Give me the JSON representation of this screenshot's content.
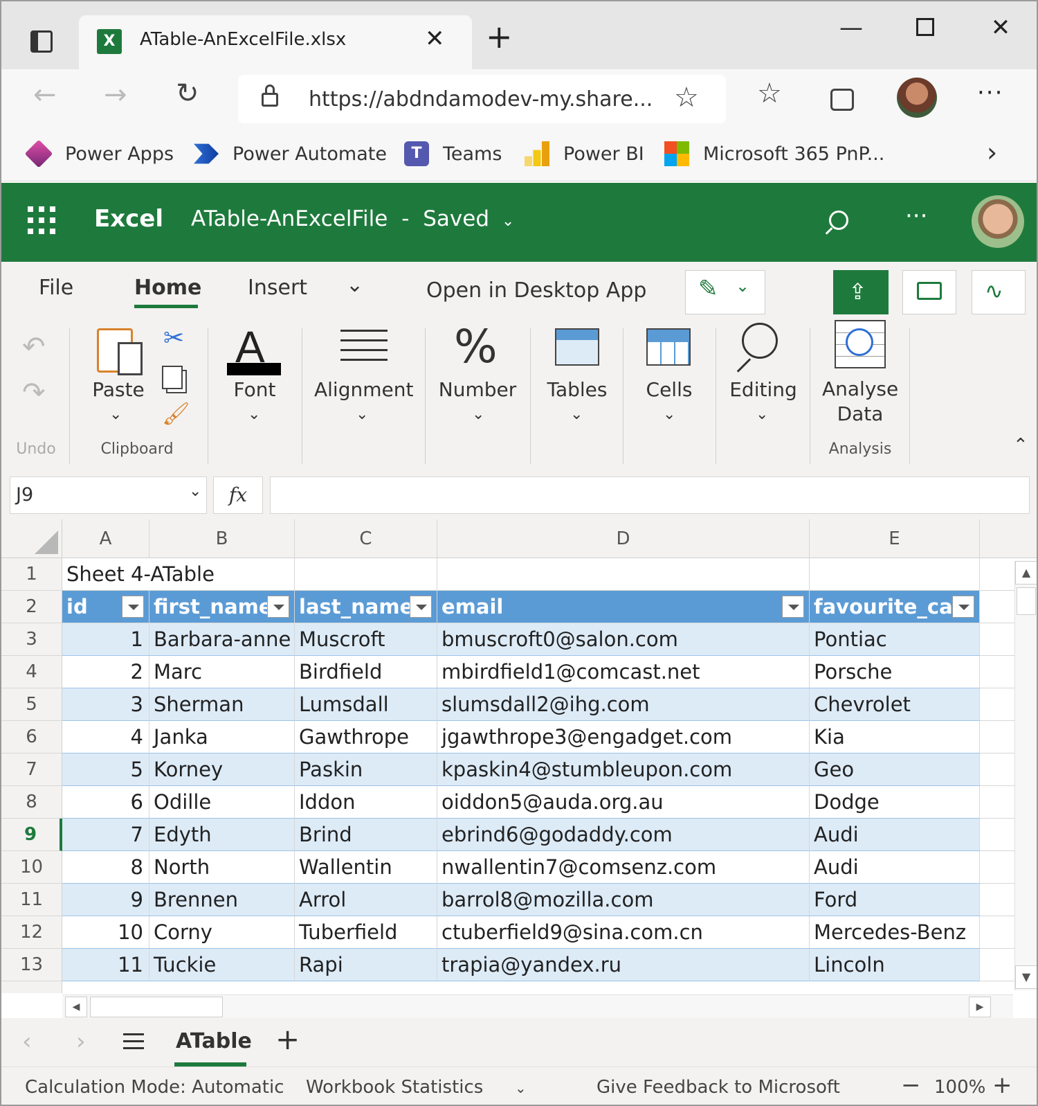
{
  "browser": {
    "tab_title": "ATable-AnExcelFile.xlsx",
    "url": "https://abdndamodev-my.share...",
    "favorites": [
      {
        "label": "Power Apps",
        "icon": "power-apps-icon",
        "color": "#a0307f"
      },
      {
        "label": "Power Automate",
        "icon": "power-automate-icon",
        "color": "#2f6fd6"
      },
      {
        "label": "Teams",
        "icon": "teams-icon",
        "color": "#5558af"
      },
      {
        "label": "Power BI",
        "icon": "power-bi-icon",
        "color": "#e8b10e"
      },
      {
        "label": "Microsoft 365 PnP...",
        "icon": "microsoft-logo-icon",
        "color": "#f25022"
      }
    ]
  },
  "app": {
    "name": "Excel",
    "file_title": "ATable-AnExcelFile",
    "separator": "-",
    "save_status": "Saved",
    "brand_color": "#1e7a3c"
  },
  "ribbon": {
    "tabs": [
      "File",
      "Home",
      "Insert"
    ],
    "open_desktop": "Open in Desktop App",
    "buttons": {
      "paste": "Paste",
      "font": "Font",
      "alignment": "Alignment",
      "number": "Number",
      "tables": "Tables",
      "cells": "Cells",
      "editing": "Editing",
      "analyse_line1": "Analyse",
      "analyse_line2": "Data"
    },
    "groups": {
      "undo": "Undo",
      "clipboard": "Clipboard",
      "analysis": "Analysis"
    }
  },
  "formula_bar": {
    "name_box": "J9",
    "fx": "fx",
    "value": ""
  },
  "grid": {
    "columns": [
      "A",
      "B",
      "C",
      "D",
      "E"
    ],
    "row_numbers": [
      "1",
      "2",
      "3",
      "4",
      "5",
      "6",
      "7",
      "8",
      "9",
      "10",
      "11",
      "12",
      "13"
    ],
    "selected_row": "9",
    "title_cell": "Sheet 4-ATable",
    "table_headers": [
      "id",
      "first_name",
      "last_name",
      "email",
      "favourite_car"
    ],
    "table_rows": [
      [
        "1",
        "Barbara-anne",
        "Muscroft",
        "bmuscroft0@salon.com",
        "Pontiac"
      ],
      [
        "2",
        "Marc",
        "Birdfield",
        "mbirdfield1@comcast.net",
        "Porsche"
      ],
      [
        "3",
        "Sherman",
        "Lumsdall",
        "slumsdall2@ihg.com",
        "Chevrolet"
      ],
      [
        "4",
        "Janka",
        "Gawthrope",
        "jgawthrope3@engadget.com",
        "Kia"
      ],
      [
        "5",
        "Korney",
        "Paskin",
        "kpaskin4@stumbleupon.com",
        "Geo"
      ],
      [
        "6",
        "Odille",
        "Iddon",
        "oiddon5@auda.org.au",
        "Dodge"
      ],
      [
        "7",
        "Edyth",
        "Brind",
        "ebrind6@godaddy.com",
        "Audi"
      ],
      [
        "8",
        "North",
        "Wallentin",
        "nwallentin7@comsenz.com",
        "Audi"
      ],
      [
        "9",
        "Brennen",
        "Arrol",
        "barrol8@mozilla.com",
        "Ford"
      ],
      [
        "10",
        "Corny",
        "Tuberfield",
        "ctuberfield9@sina.com.cn",
        "Mercedes-Benz"
      ],
      [
        "11",
        "Tuckie",
        "Rapi",
        "trapia@yandex.ru",
        "Lincoln"
      ]
    ],
    "header_color": "#5b9bd5",
    "band_color": "#ddebf7"
  },
  "sheets": {
    "active": "ATable"
  },
  "status_bar": {
    "calc_mode": "Calculation Mode: Automatic",
    "workbook_stats": "Workbook Statistics",
    "feedback": "Give Feedback to Microsoft",
    "zoom": "100%"
  }
}
